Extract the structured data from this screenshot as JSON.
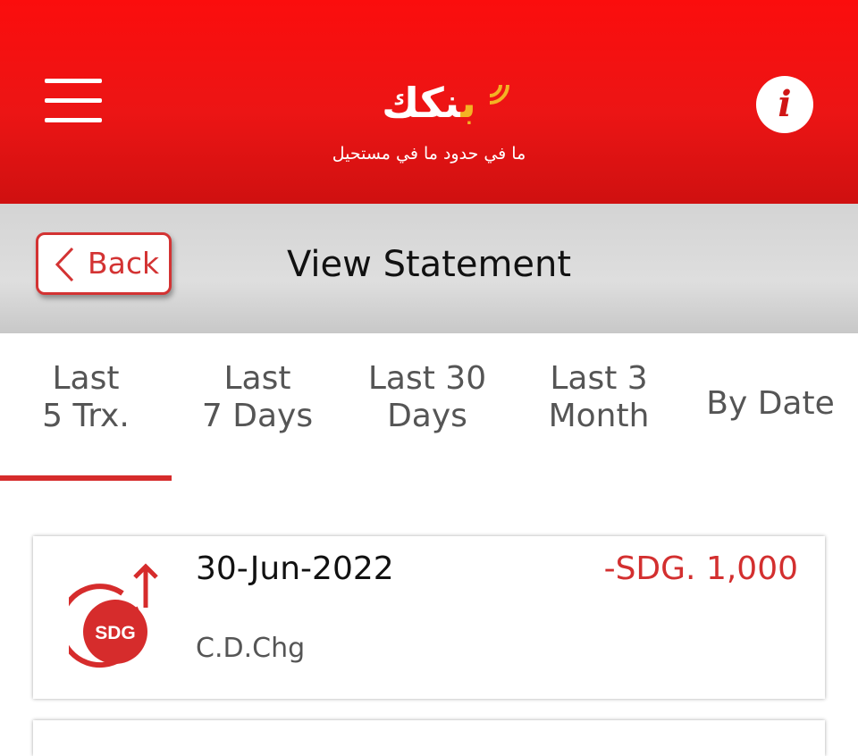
{
  "header": {
    "brand_name_accent": "ب",
    "brand_name_main": "نكك",
    "brand_tagline": "ما في حدود ما في مستحيل",
    "menu_icon": "hamburger-menu-icon",
    "info_icon": "info-icon",
    "info_glyph": "i",
    "colors": {
      "primary": "#ec1515",
      "accent": "#f3b324"
    }
  },
  "subheader": {
    "back_label": "Back",
    "title": "View Statement"
  },
  "tabs": [
    {
      "lines": [
        "Last",
        "5 Trx."
      ],
      "active": true
    },
    {
      "lines": [
        "Last",
        "7 Days"
      ],
      "active": false
    },
    {
      "lines": [
        "Last 30",
        "Days"
      ],
      "active": false
    },
    {
      "lines": [
        "Last 3",
        "Month"
      ],
      "active": false
    },
    {
      "lines": [
        "By Date"
      ],
      "active": false
    }
  ],
  "transactions": [
    {
      "date": "30-Jun-2022",
      "amount": "-SDG. 1,000",
      "description": "C.D.Chg",
      "icon": "sdg-outgoing-icon",
      "currency_badge": "SDG"
    }
  ]
}
